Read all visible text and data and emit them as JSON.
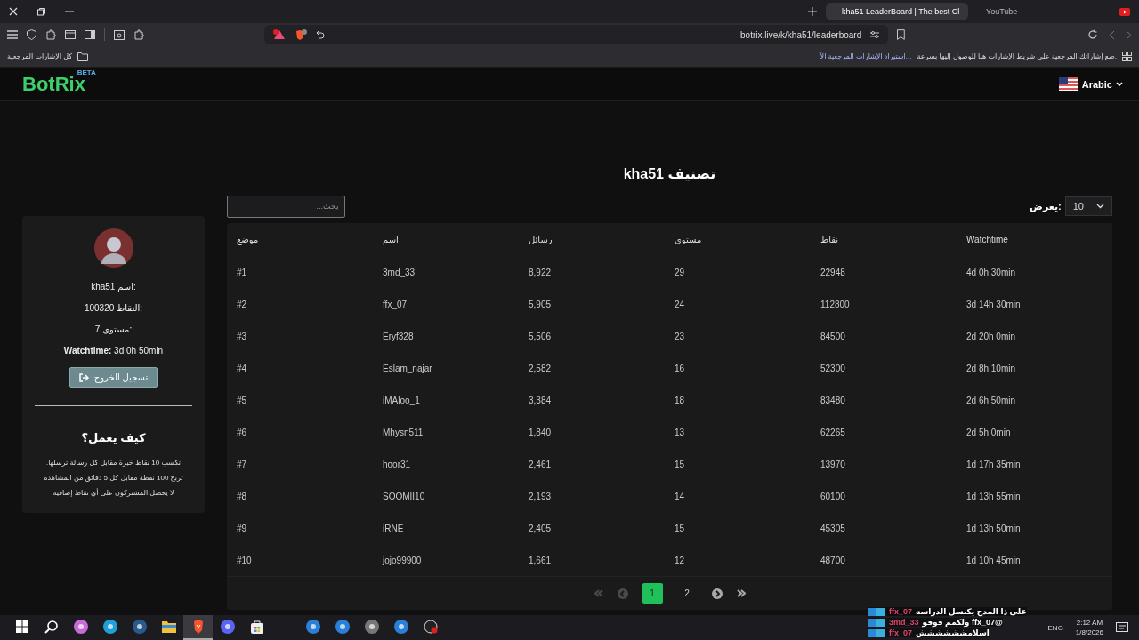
{
  "browser": {
    "tabs": [
      {
        "label": "kha51 LeaderBoard | The best Cl",
        "selected": true
      },
      {
        "label": "YouTube",
        "selected": false
      }
    ],
    "url": "botrix.live/k/kha51/leaderboard",
    "bookmarks": {
      "folder": "كل الإشارات المرجعية",
      "hint": "ضع إشاراتك المرجعية على شريط الإشارات هنا للوصول إليها بسرعة.",
      "import_link": "استيراد الإشارات المرجعية الآ..."
    }
  },
  "site": {
    "logo": "BotRix",
    "badge": "BETA",
    "language": "Arabic"
  },
  "profile": {
    "lines": [
      "kha51 اسم:",
      "100320 النقاط:",
      "7 مستوى:",
      "**Watchtime:** 3d 0h 50min"
    ],
    "logout": "تسجيل الخروج",
    "help_title": "كيف يعمل؟",
    "help_lines": [
      "تكسب 10 نقاط خبرة مقابل كل رسالة ترسلها.",
      "تربح 100 نقطة مقابل كل 5 دقائق من المشاهدة",
      "لا يحصل المشتركون على أي نقاط إضافية"
    ]
  },
  "leaderboard": {
    "title": "kha51 تصنيف",
    "search": {
      "placeholder": "بحث..."
    },
    "show_label": "يعرض:",
    "page_size": "10",
    "columns": [
      "موضع",
      "اسم",
      "رسائل",
      "مستوى",
      "نقاط",
      "Watchtime"
    ],
    "rows": [
      [
        "#1",
        "3md_33",
        "8,922",
        "29",
        "22948",
        "4d 0h 30min"
      ],
      [
        "#2",
        "ffx_07",
        "5,905",
        "24",
        "112800",
        "3d 14h 30min"
      ],
      [
        "#3",
        "Eryf328",
        "5,506",
        "23",
        "84500",
        "2d 20h 0min"
      ],
      [
        "#4",
        "Eslam_najar",
        "2,582",
        "16",
        "52300",
        "2d 8h 10min"
      ],
      [
        "#5",
        "iMAloo_1",
        "3,384",
        "18",
        "83480",
        "2d 6h 50min"
      ],
      [
        "#6",
        "Mhysn511",
        "1,840",
        "13",
        "62265",
        "2d 5h 0min"
      ],
      [
        "#7",
        "hoor31",
        "2,461",
        "15",
        "13970",
        "1d 17h 35min"
      ],
      [
        "#8",
        "SOOMII10",
        "2,193",
        "14",
        "60100",
        "1d 13h 55min"
      ],
      [
        "#9",
        "iRNE",
        "2,405",
        "15",
        "45305",
        "1d 13h 50min"
      ],
      [
        "#10",
        "jojo99900",
        "1,661",
        "12",
        "48700",
        "1d 10h 45min"
      ]
    ],
    "pagination": [
      {
        "kind": "first",
        "disabled": true
      },
      {
        "kind": "prev",
        "disabled": true
      },
      {
        "kind": "page",
        "label": "1",
        "selected": true
      },
      {
        "kind": "page",
        "label": "2",
        "selected": false
      },
      {
        "kind": "next",
        "disabled": false
      },
      {
        "kind": "last",
        "disabled": false
      }
    ]
  },
  "chat": [
    {
      "user": "ffx_07",
      "color": "#e0456a",
      "text": "على ذا المدح يكنسل الدراسه"
    },
    {
      "user": "3md_33",
      "color": "#e0456a",
      "text": "@ffx_07 ولكمم فوفو"
    },
    {
      "user": "ffx_07",
      "color": "#e0456a",
      "text": "اسلامشششششش"
    }
  ],
  "taskbar": {
    "apps": [
      {
        "kind": "start",
        "selected": false
      },
      {
        "kind": "search",
        "selected": false
      },
      {
        "kind": "copilot",
        "selected": false
      },
      {
        "kind": "edge",
        "selected": false
      },
      {
        "kind": "steam",
        "selected": false
      },
      {
        "kind": "folder",
        "selected": false
      },
      {
        "kind": "brave",
        "selected": true
      },
      {
        "kind": "discord",
        "selected": false
      },
      {
        "kind": "store",
        "selected": false
      },
      {
        "kind": "mail",
        "selected": false
      },
      {
        "kind": "blue",
        "selected": false
      },
      {
        "kind": "gray",
        "selected": false
      },
      {
        "kind": "blue",
        "selected": false
      },
      {
        "kind": "record",
        "selected": false
      }
    ],
    "lang": "ENG",
    "time": "2:12 AM",
    "date": "1/8/2026"
  }
}
